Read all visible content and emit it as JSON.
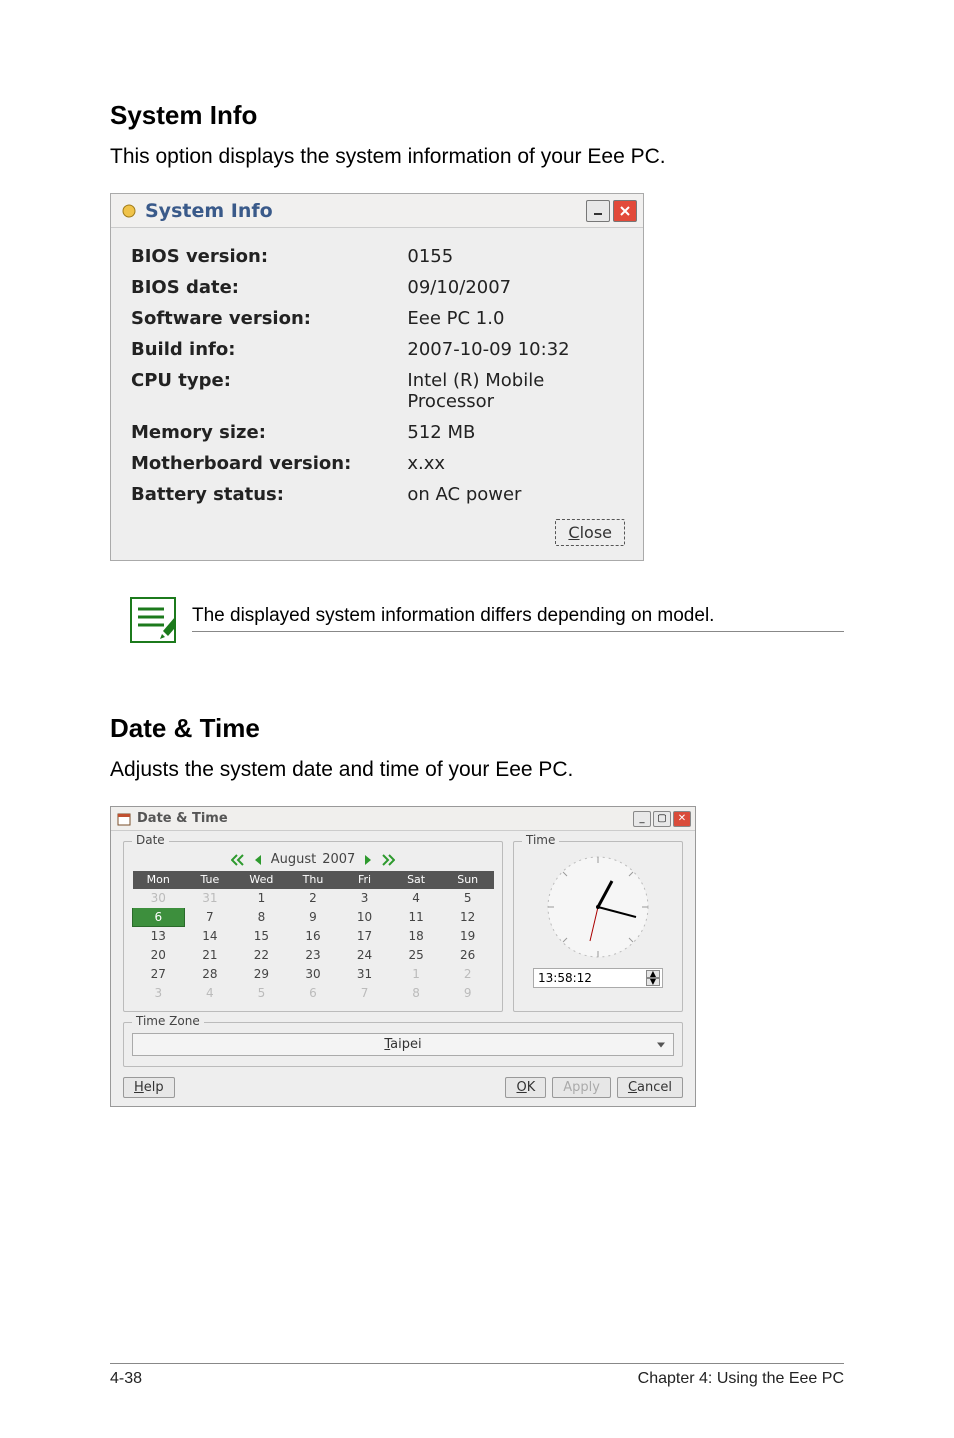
{
  "sections": {
    "sysinfo": {
      "heading": "System Info",
      "description": "This option displays the system information of your Eee PC.",
      "window_title": "System Info",
      "rows": [
        {
          "label": "BIOS version:",
          "value": "0155"
        },
        {
          "label": "BIOS date:",
          "value": "09/10/2007"
        },
        {
          "label": "Software version:",
          "value": "Eee PC 1.0"
        },
        {
          "label": "Build info:",
          "value": "2007-10-09 10:32"
        },
        {
          "label": "CPU type:",
          "value": "Intel (R) Mobile Processor"
        },
        {
          "label": "Memory size:",
          "value": "512 MB"
        },
        {
          "label": "Motherboard version:",
          "value": "x.xx"
        },
        {
          "label": "Battery status:",
          "value": "on AC power"
        }
      ],
      "close_label": "Close"
    },
    "note": "The displayed system information differs depending on model.",
    "datetime": {
      "heading": "Date & Time",
      "description": "Adjusts the system date and time of your Eee PC.",
      "window_title": "Date & Time",
      "date_legend": "Date",
      "time_legend": "Time",
      "timezone_legend": "Time Zone",
      "month": "August",
      "year": "2007",
      "weekdays": [
        "Mon",
        "Tue",
        "Wed",
        "Thu",
        "Fri",
        "Sat",
        "Sun"
      ],
      "calendar": [
        [
          {
            "d": "30",
            "other": true
          },
          {
            "d": "31",
            "other": true
          },
          {
            "d": "1"
          },
          {
            "d": "2"
          },
          {
            "d": "3"
          },
          {
            "d": "4"
          },
          {
            "d": "5"
          }
        ],
        [
          {
            "d": "6",
            "sel": true
          },
          {
            "d": "7"
          },
          {
            "d": "8"
          },
          {
            "d": "9"
          },
          {
            "d": "10"
          },
          {
            "d": "11"
          },
          {
            "d": "12"
          }
        ],
        [
          {
            "d": "13"
          },
          {
            "d": "14"
          },
          {
            "d": "15"
          },
          {
            "d": "16"
          },
          {
            "d": "17"
          },
          {
            "d": "18"
          },
          {
            "d": "19"
          }
        ],
        [
          {
            "d": "20"
          },
          {
            "d": "21"
          },
          {
            "d": "22"
          },
          {
            "d": "23"
          },
          {
            "d": "24"
          },
          {
            "d": "25"
          },
          {
            "d": "26"
          }
        ],
        [
          {
            "d": "27"
          },
          {
            "d": "28"
          },
          {
            "d": "29"
          },
          {
            "d": "30"
          },
          {
            "d": "31"
          },
          {
            "d": "1",
            "other": true
          },
          {
            "d": "2",
            "other": true
          }
        ],
        [
          {
            "d": "3",
            "other": true
          },
          {
            "d": "4",
            "other": true
          },
          {
            "d": "5",
            "other": true
          },
          {
            "d": "6",
            "other": true
          },
          {
            "d": "7",
            "other": true
          },
          {
            "d": "8",
            "other": true
          },
          {
            "d": "9",
            "other": true
          }
        ]
      ],
      "time_value": "13:58:12",
      "timezone_value": "Taipei",
      "buttons": {
        "help": "Help",
        "ok": "OK",
        "apply": "Apply",
        "cancel": "Cancel"
      }
    }
  },
  "footer": {
    "page_num": "4-38",
    "chapter": "Chapter 4: Using the Eee PC"
  }
}
